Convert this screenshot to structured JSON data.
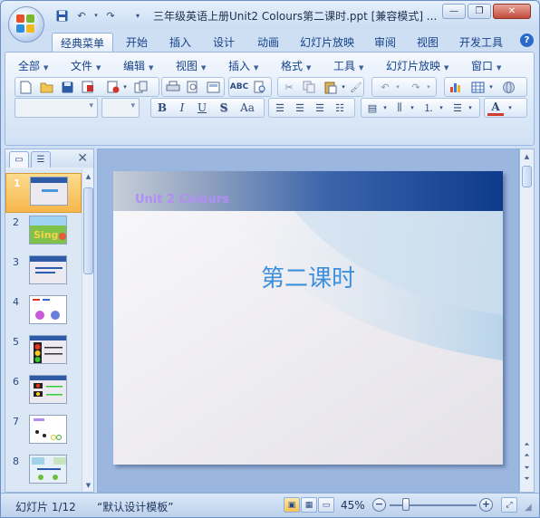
{
  "window": {
    "title": "三年级英语上册Unit2 Colours第二课时.ppt [兼容模式] ...",
    "minimize_label": "—",
    "restore_label": "❐",
    "close_label": "✕"
  },
  "quick_access": [
    "save-icon",
    "undo-icon",
    "redo-icon",
    "customize-icon"
  ],
  "tabs": [
    {
      "label": "经典菜单",
      "active": true
    },
    {
      "label": "开始"
    },
    {
      "label": "插入"
    },
    {
      "label": "设计"
    },
    {
      "label": "动画"
    },
    {
      "label": "幻灯片放映"
    },
    {
      "label": "审阅"
    },
    {
      "label": "视图"
    },
    {
      "label": "开发工具"
    }
  ],
  "help_label": "?",
  "menus": [
    "全部",
    "文件",
    "编辑",
    "视图",
    "插入",
    "格式",
    "工具",
    "幻灯片放映",
    "窗口"
  ],
  "font_combo": {
    "value": ""
  },
  "size_combo": {
    "value": ""
  },
  "format_buttons": {
    "bold": "B",
    "italic": "I",
    "underline": "U",
    "shadow": "S",
    "case": "Aa"
  },
  "slides": [
    {
      "num": "1",
      "selected": true
    },
    {
      "num": "2"
    },
    {
      "num": "3"
    },
    {
      "num": "4"
    },
    {
      "num": "5"
    },
    {
      "num": "6"
    },
    {
      "num": "7"
    },
    {
      "num": "8"
    }
  ],
  "current_slide": {
    "header_text": "Unit 2  Colours",
    "title": "第二课时"
  },
  "status": {
    "slide_info": "幻灯片 1/12",
    "template": "“默认设计模板”",
    "zoom": "45%"
  },
  "colors": {
    "header_text": "#b38df6",
    "slide_title": "#3e8fd9",
    "selected_thumb": "#f7b64b"
  }
}
